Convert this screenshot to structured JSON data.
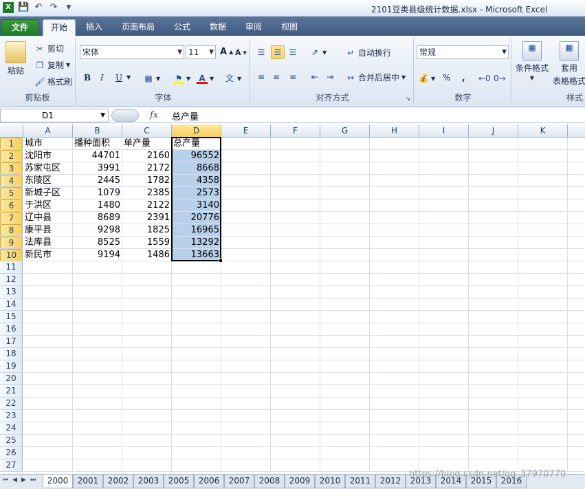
{
  "window": {
    "title": "2101豆类县级统计数据.xlsx  -  Microsoft Excel",
    "qat_icons": [
      "save-icon",
      "undo-icon",
      "redo-icon",
      "customize-icon"
    ]
  },
  "tabs": {
    "file": "文件",
    "items": [
      "开始",
      "插入",
      "页面布局",
      "公式",
      "数据",
      "审阅",
      "视图"
    ],
    "active_index": 0
  },
  "ribbon": {
    "clipboard": {
      "label": "剪贴板",
      "paste": "粘贴",
      "cut": "剪切",
      "copy": "复制",
      "format_painter": "格式刷"
    },
    "font": {
      "label": "字体",
      "font_name": "宋体",
      "font_size": "11",
      "bold": "B",
      "italic": "I",
      "underline": "U"
    },
    "alignment": {
      "label": "对齐方式",
      "wrap_text": "自动换行",
      "merge_center": "合并后居中"
    },
    "number": {
      "label": "数字",
      "format": "常规",
      "percent": "%",
      "comma": ","
    },
    "styles": {
      "label": "样式",
      "conditional": "条件格式",
      "table_format_1": "套用",
      "table_format_2": "表格格式"
    }
  },
  "formula_bar": {
    "name_box": "D1",
    "fx": "fx",
    "content": "总产量"
  },
  "columns": [
    "A",
    "B",
    "C",
    "D",
    "E",
    "F",
    "G",
    "H",
    "I",
    "J",
    "K"
  ],
  "selected_column": "D",
  "row_count": 27,
  "table": {
    "headers": [
      "城市",
      "播种面积",
      "单产量",
      "总产量"
    ],
    "rows": [
      [
        "沈阳市",
        "44701",
        "2160",
        "96552"
      ],
      [
        "苏家屯区",
        "3991",
        "2172",
        "8668"
      ],
      [
        "东陵区",
        "2445",
        "1782",
        "4358"
      ],
      [
        "新城子区",
        "1079",
        "2385",
        "2573"
      ],
      [
        "于洪区",
        "1480",
        "2122",
        "3140"
      ],
      [
        "辽中县",
        "8689",
        "2391",
        "20776"
      ],
      [
        "康平县",
        "9298",
        "1825",
        "16965"
      ],
      [
        "法库县",
        "8525",
        "1559",
        "13292"
      ],
      [
        "新民市",
        "9194",
        "1486",
        "13663"
      ]
    ]
  },
  "sheets": [
    "2000",
    "2001",
    "2002",
    "2003",
    "2005",
    "2006",
    "2007",
    "2008",
    "2009",
    "2010",
    "2011",
    "2012",
    "2013",
    "2014",
    "2015",
    "2016"
  ],
  "active_sheet": "2000",
  "watermark": "https://blog.csdn.net/qq_37970770",
  "colors": {
    "tab_bar": "#4b6790",
    "file_tab": "#2a8a35",
    "selection_fill": "#b8d0ea",
    "header_selected": "#fbd46a"
  }
}
